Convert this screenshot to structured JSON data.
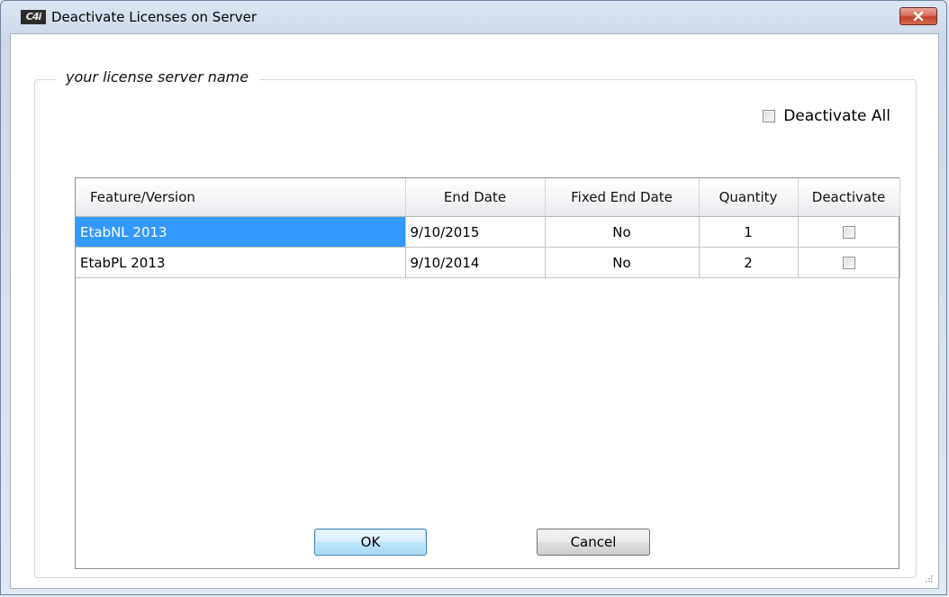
{
  "window": {
    "title": "Deactivate Licenses on Server",
    "icon_text": "C4i"
  },
  "group": {
    "label": "your license server name"
  },
  "deactivate_all": {
    "label": "Deactivate All",
    "checked": false
  },
  "table": {
    "columns": [
      "Feature/Version",
      "End Date",
      "Fixed End Date",
      "Quantity",
      "Deactivate"
    ],
    "rows": [
      {
        "feature": "EtabNL 2013",
        "end_date": "9/10/2015",
        "fixed_end_date": "No",
        "quantity": "1",
        "deactivate": false,
        "selected": true
      },
      {
        "feature": "EtabPL 2013",
        "end_date": "9/10/2014",
        "fixed_end_date": "No",
        "quantity": "2",
        "deactivate": false,
        "selected": false
      }
    ]
  },
  "buttons": {
    "ok": "OK",
    "cancel": "Cancel"
  },
  "colors": {
    "selection": "#3399ff",
    "close_button": "#c4402a"
  }
}
